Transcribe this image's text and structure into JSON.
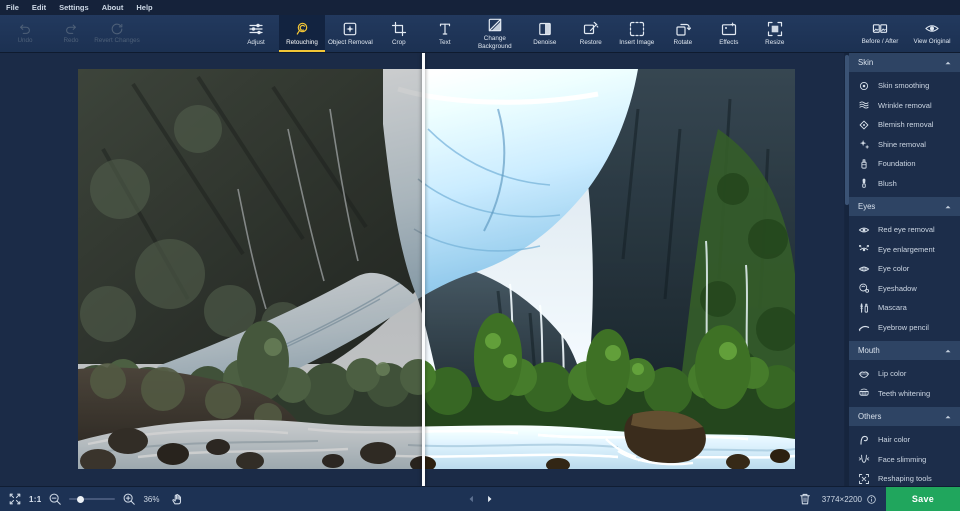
{
  "menu": {
    "items": [
      "File",
      "Edit",
      "Settings",
      "About",
      "Help"
    ]
  },
  "toolbar": {
    "history": [
      {
        "label": "Undo",
        "icon": "undo-icon",
        "enabled": false
      },
      {
        "label": "Redo",
        "icon": "redo-icon",
        "enabled": false
      },
      {
        "label": "Revert Changes",
        "icon": "revert-changes-icon",
        "enabled": false
      }
    ],
    "tools": [
      {
        "label": "Adjust",
        "icon": "adjust-icon",
        "active": false
      },
      {
        "label": "Retouching",
        "icon": "retouching-icon",
        "active": true
      },
      {
        "label": "Object Removal",
        "icon": "object-removal-icon",
        "active": false
      },
      {
        "label": "Crop",
        "icon": "crop-icon",
        "active": false
      },
      {
        "label": "Text",
        "icon": "text-icon",
        "active": false
      },
      {
        "label": "Change Background",
        "icon": "change-background-icon",
        "active": false
      },
      {
        "label": "Denoise",
        "icon": "denoise-icon",
        "active": false
      },
      {
        "label": "Restore",
        "icon": "restore-icon",
        "active": false
      },
      {
        "label": "Insert Image",
        "icon": "insert-image-icon",
        "active": false
      },
      {
        "label": "Rotate",
        "icon": "rotate-icon",
        "active": false
      },
      {
        "label": "Effects",
        "icon": "effects-icon",
        "active": false
      },
      {
        "label": "Resize",
        "icon": "resize-icon",
        "active": false
      }
    ],
    "view_buttons": [
      {
        "label": "Before / After",
        "icon": "before-after-icon"
      },
      {
        "label": "View Original",
        "icon": "view-original-icon"
      }
    ]
  },
  "sidebar": {
    "sections": [
      {
        "title": "Skin",
        "collapse_icon": "collapse-up-icon",
        "items": [
          {
            "label": "Skin smoothing",
            "icon": "skin-smoothing-icon"
          },
          {
            "label": "Wrinkle removal",
            "icon": "wrinkle-removal-icon"
          },
          {
            "label": "Blemish removal",
            "icon": "blemish-removal-icon"
          },
          {
            "label": "Shine removal",
            "icon": "shine-removal-icon"
          },
          {
            "label": "Foundation",
            "icon": "foundation-icon"
          },
          {
            "label": "Blush",
            "icon": "blush-icon"
          }
        ]
      },
      {
        "title": "Eyes",
        "collapse_icon": "collapse-up-icon",
        "items": [
          {
            "label": "Red eye removal",
            "icon": "red-eye-removal-icon"
          },
          {
            "label": "Eye enlargement",
            "icon": "eye-enlargement-icon"
          },
          {
            "label": "Eye color",
            "icon": "eye-color-icon"
          },
          {
            "label": "Eyeshadow",
            "icon": "eyeshadow-icon"
          },
          {
            "label": "Mascara",
            "icon": "mascara-icon"
          },
          {
            "label": "Eyebrow pencil",
            "icon": "eyebrow-pencil-icon"
          }
        ]
      },
      {
        "title": "Mouth",
        "collapse_icon": "collapse-up-icon",
        "items": [
          {
            "label": "Lip color",
            "icon": "lip-color-icon"
          },
          {
            "label": "Teeth whitening",
            "icon": "teeth-whitening-icon"
          }
        ]
      },
      {
        "title": "Others",
        "collapse_icon": "collapse-up-icon",
        "items": [
          {
            "label": "Hair color",
            "icon": "hair-color-icon"
          },
          {
            "label": "Face slimming",
            "icon": "face-slimming-icon"
          },
          {
            "label": "Reshaping tools",
            "icon": "reshaping-tools-icon"
          }
        ]
      }
    ]
  },
  "statusbar": {
    "fit_icon": "fit-screen-icon",
    "scale_label": "1:1",
    "zoom_out_icon": "zoom-out-icon",
    "zoom_in_icon": "zoom-in-icon",
    "zoom_value": "36%",
    "pan_icon": "pan-hand-icon",
    "prev_icon": "previous-icon",
    "next_icon": "next-icon",
    "delete_icon": "trash-icon",
    "image_dimensions": "3774×2200",
    "info_icon": "info-icon",
    "save_label": "Save"
  },
  "colors": {
    "accent_yellow": "#f3c636",
    "save_green": "#20a65d",
    "menubar_bg": "#15223a",
    "toolbar_bg": "#1d3254",
    "canvas_bg": "#1b2b47",
    "section_header_bg": "#2e4464",
    "divider_white": "#fbfcfd"
  }
}
